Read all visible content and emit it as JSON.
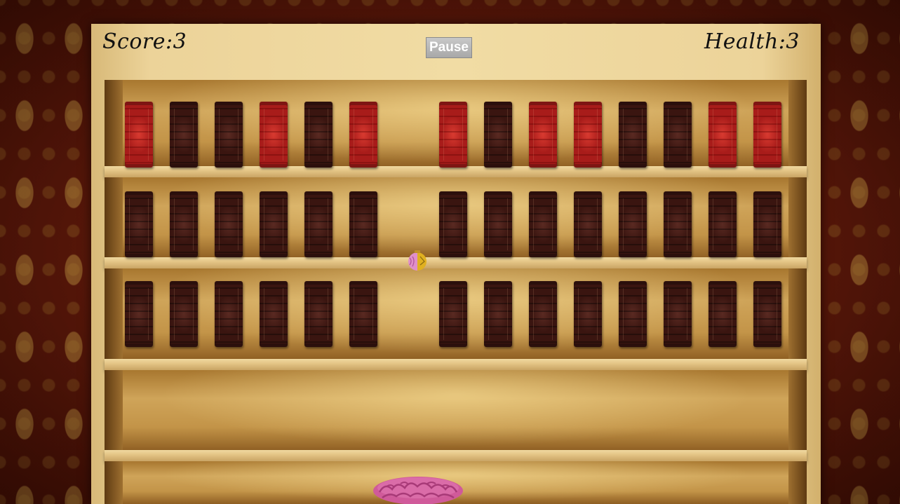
{
  "hud": {
    "score_label": "Score:3",
    "health_label": "Health:3",
    "pause_label": "Pause"
  },
  "bricks": {
    "rows": [
      [
        "red",
        "dark",
        "dark",
        "red",
        "dark",
        "red",
        null,
        "red",
        "dark",
        "red",
        "red",
        "dark",
        "dark",
        "red",
        "red"
      ],
      [
        "dark",
        "dark",
        "dark",
        "dark",
        "dark",
        "dark",
        null,
        "dark",
        "dark",
        "dark",
        "dark",
        "dark",
        "dark",
        "dark",
        "dark"
      ],
      [
        "dark",
        "dark",
        "dark",
        "dark",
        "dark",
        "dark",
        null,
        "dark",
        "dark",
        "dark",
        "dark",
        "dark",
        "dark",
        "dark",
        "dark"
      ]
    ]
  },
  "ball": {
    "icon": "half-pink-half-yellow-ball-icon"
  },
  "paddle": {
    "icon": "pink-brain-icon",
    "color": "#d05a9a"
  },
  "colors": {
    "red_book": "#c42a25",
    "dark_book": "#4a1c16",
    "wood": "#ecd399"
  }
}
